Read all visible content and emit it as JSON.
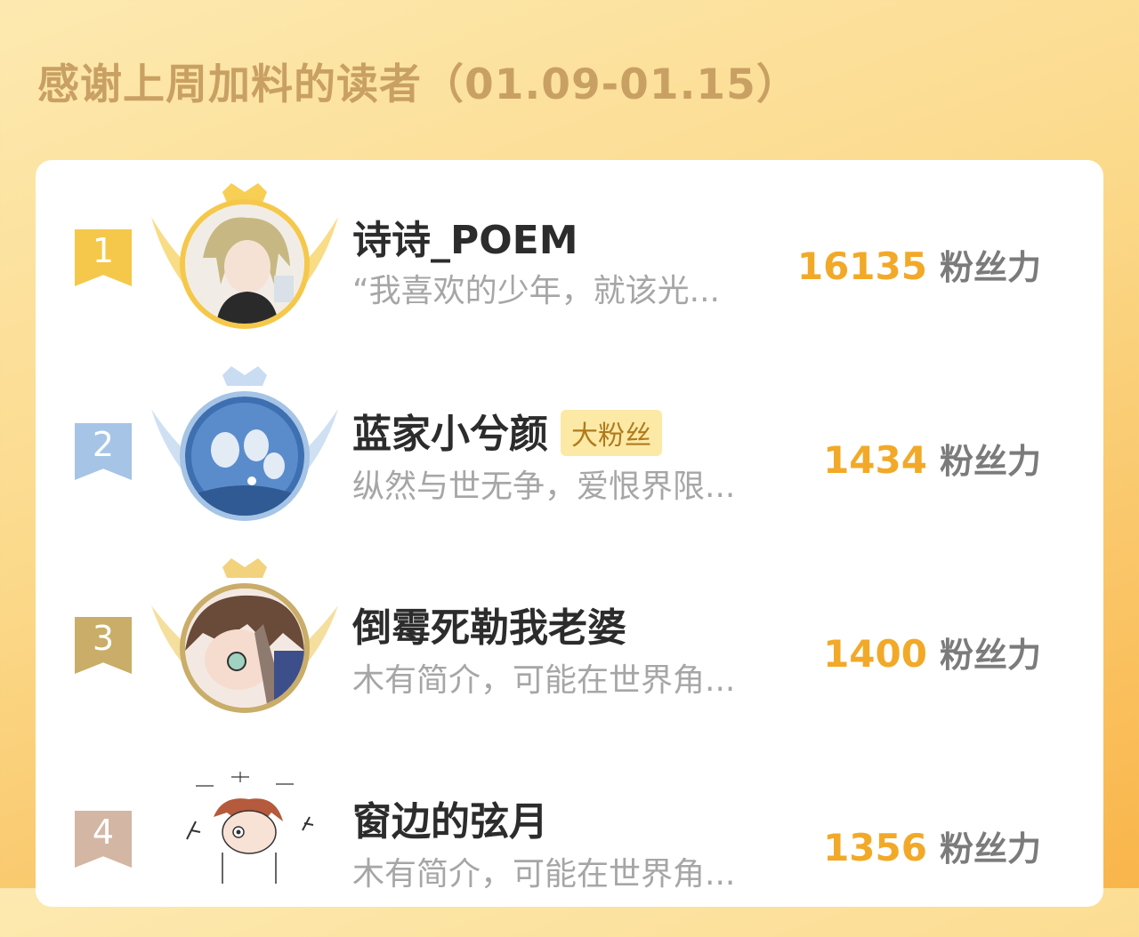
{
  "header": {
    "title": "感谢上周加料的读者（01.09-01.15）"
  },
  "score_unit": "粉丝力",
  "readers": [
    {
      "rank": "1",
      "name": "诗诗_POEM",
      "badge": "",
      "bio": "“我喜欢的少年，就该光...",
      "score": "16135",
      "medal_color": "#f5c84b",
      "avatar_icon": "anime-character-avatar"
    },
    {
      "rank": "2",
      "name": "蓝家小兮颜",
      "badge": "大粉丝",
      "bio": "纵然与世无争，爱恨界限...",
      "score": "1434",
      "medal_color": "#a5c4e6",
      "avatar_icon": "blue-group-avatar"
    },
    {
      "rank": "3",
      "name": "倒霉死勒我老婆",
      "badge": "",
      "bio": "木有简介，可能在世界角...",
      "score": "1400",
      "medal_color": "#c9ad68",
      "avatar_icon": "brown-hair-avatar"
    },
    {
      "rank": "4",
      "name": "窗边的弦月",
      "badge": "",
      "bio": "木有简介，可能在世界角...",
      "score": "1356",
      "medal_color": "#d3b6a4",
      "avatar_icon": "doodle-avatar"
    }
  ]
}
